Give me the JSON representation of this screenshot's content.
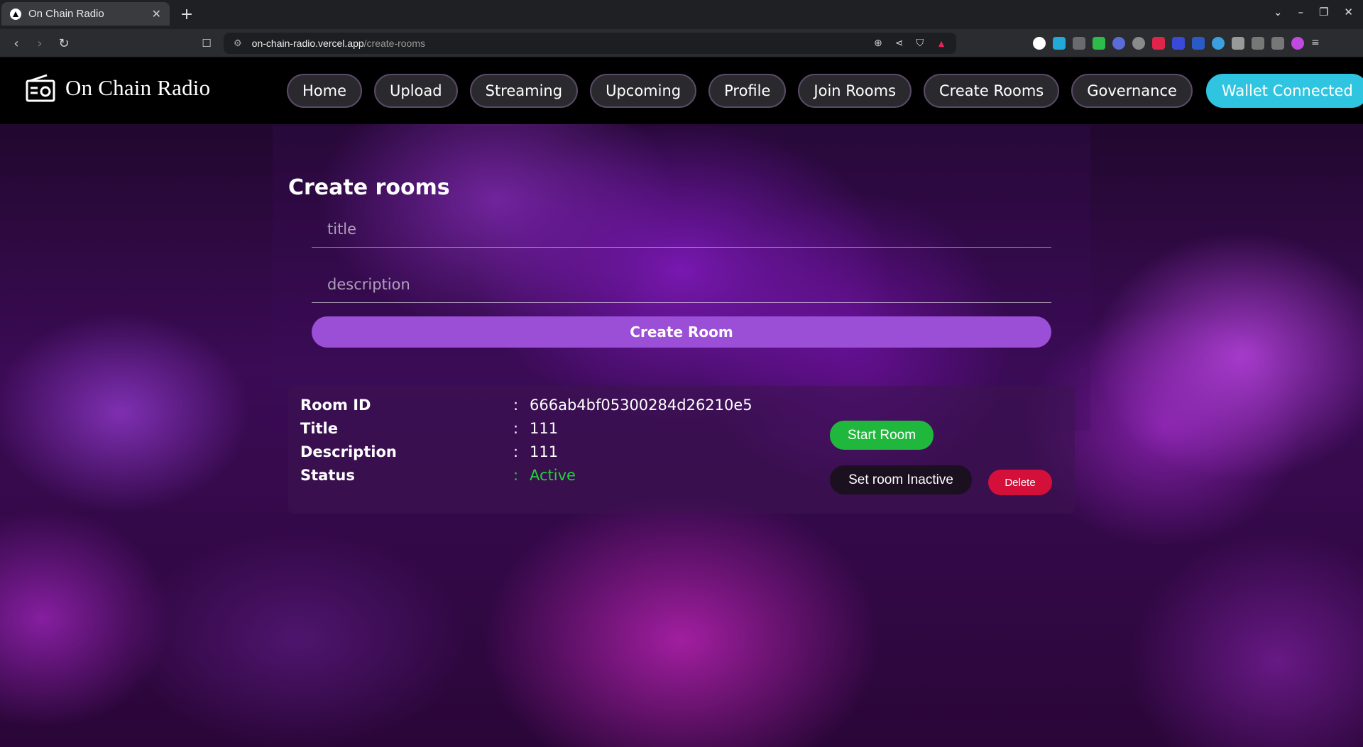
{
  "browser": {
    "tab_title": "On Chain Radio",
    "url_host": "on-chain-radio.vercel.app",
    "url_path": "/create-rooms"
  },
  "nav": {
    "brand": "On Chain Radio",
    "links": [
      "Home",
      "Upload",
      "Streaming",
      "Upcoming",
      "Profile",
      "Join Rooms",
      "Create Rooms",
      "Governance"
    ],
    "wallet": "Wallet Connected"
  },
  "form": {
    "heading": "Create rooms",
    "title_placeholder": "title",
    "description_placeholder": "description",
    "submit_label": "Create Room"
  },
  "room": {
    "rows": [
      {
        "key": "Room ID",
        "sep": ":",
        "value": "666ab4bf05300284d26210e5"
      },
      {
        "key": "Title",
        "sep": ":",
        "value": "111"
      },
      {
        "key": "Description",
        "sep": ":",
        "value": "111"
      },
      {
        "key": "Status",
        "sep": ":",
        "value": "Active"
      }
    ],
    "start_label": "Start Room",
    "inactive_label": "Set room Inactive",
    "delete_label": "Delete",
    "status_color": "#22d33a"
  },
  "colors": {
    "wallet_button": "#2fc4e0",
    "create_button": "#9a4fd6",
    "start_button": "#20b83c",
    "delete_button": "#d4103a"
  }
}
